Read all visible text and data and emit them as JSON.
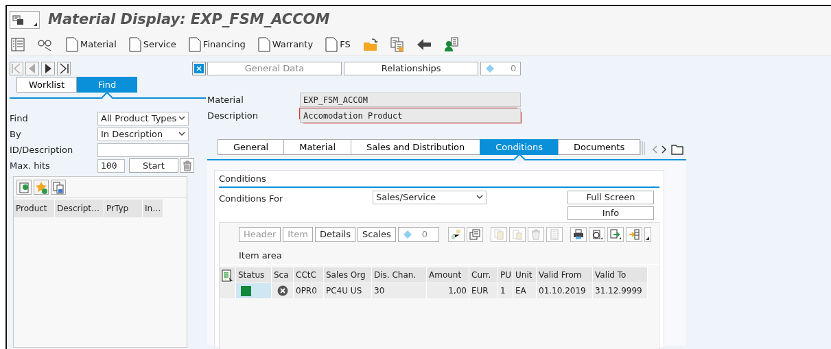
{
  "window": {
    "title": "Material Display: EXP_FSM_ACCOM"
  },
  "toolbar_buttons": [
    "Material",
    "Service",
    "Financing",
    "Warranty",
    "FS"
  ],
  "header_tabs": [
    {
      "label": "General Data",
      "disabled": true
    },
    {
      "label": "Relationships",
      "disabled": false
    }
  ],
  "relationships_count": "0",
  "left_tabs": [
    {
      "label": "Worklist",
      "selected": false
    },
    {
      "label": "Find",
      "selected": true
    }
  ],
  "find_fields": [
    {
      "label": "Find",
      "kind": "select",
      "value": "All Product Types"
    },
    {
      "label": "By",
      "kind": "select",
      "value": "In Description"
    },
    {
      "label": "ID/Description",
      "kind": "input"
    },
    {
      "label": "Max. hits",
      "kind": "number",
      "value": "100"
    }
  ],
  "start_button": "Start",
  "result_columns": [
    "Product",
    "Descript…",
    "PrTyp",
    "In…"
  ],
  "material": {
    "label": "Material",
    "value": "EXP_FSM_ACCOM",
    "required": false
  },
  "description": {
    "label": "Description",
    "value": "Accomodation Product",
    "required": true
  },
  "detail_tabs": [
    {
      "label": "General",
      "selected": false
    },
    {
      "label": "Material",
      "selected": false
    },
    {
      "label": "Sales and Distribution",
      "selected": false
    },
    {
      "label": "Conditions",
      "selected": true
    },
    {
      "label": "Documents",
      "selected": false
    }
  ],
  "conditions": {
    "title": "Conditions",
    "for_label": "Conditions For",
    "for_value": "Sales/Service",
    "side_buttons": [
      "Full Screen",
      "Info"
    ],
    "table_buttons": [
      {
        "label": "Header",
        "disabled": true
      },
      {
        "label": "Item",
        "disabled": true
      },
      {
        "label": "Details",
        "disabled": false
      },
      {
        "label": "Scales",
        "disabled": false
      }
    ],
    "count": "0",
    "item_area": "Item area",
    "columns": [
      "Status",
      "Sca",
      "CCtC",
      "Sales Org",
      "Dis. Chan.",
      "Amount",
      "Curr.",
      "PU",
      "Unit",
      "Valid From",
      "Valid To"
    ],
    "rows": [
      {
        "color": "#12883a",
        "cells": [
          "",
          "",
          "0PR0",
          "PC4U US",
          "30",
          "1,00",
          "EUR",
          "1",
          "EA",
          "01.10.2019",
          "31.12.9999"
        ]
      }
    ]
  }
}
